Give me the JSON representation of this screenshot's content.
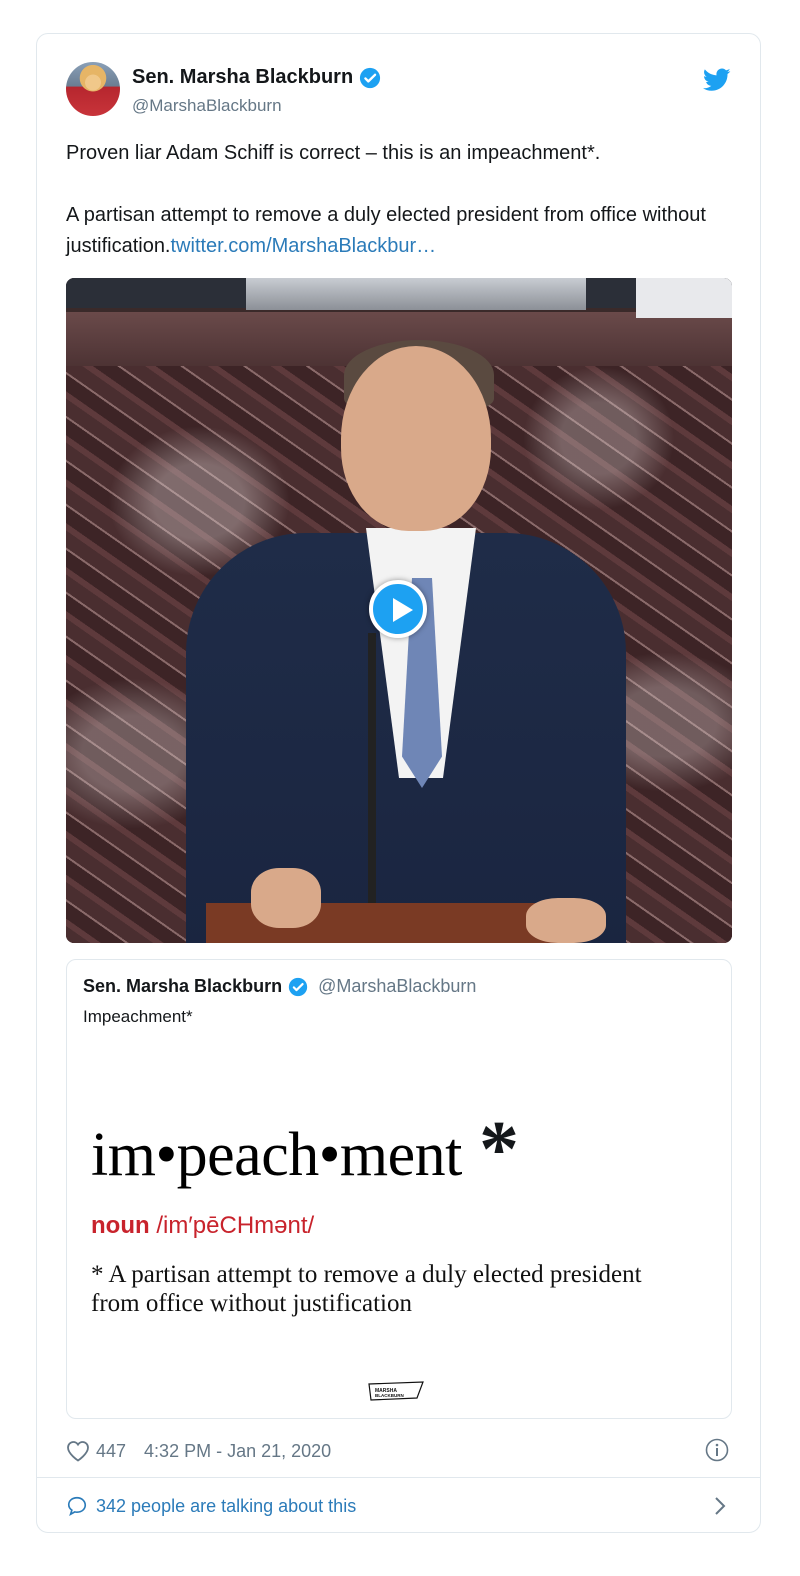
{
  "tweet": {
    "author_name": "Sen. Marsha Blackburn",
    "author_handle": "@MarshaBlackburn",
    "text_line1": "Proven liar Adam Schiff is correct – this is an impeachment*.",
    "text_line2": "A partisan attempt to remove a duly elected president from office without justification.",
    "link_text": "twitter.com/MarshaBlackbur…"
  },
  "quoted_tweet": {
    "author_name": "Sen. Marsha Blackburn",
    "author_handle": "@MarshaBlackburn",
    "text": "Impeachment*",
    "image": {
      "word": "im•peach•ment",
      "star": "*",
      "pos": "noun",
      "pronunciation": "/im′pēCHmənt/",
      "definition": "* A partisan attempt to remove a duly elected president from office without justification",
      "logo_text": "MARSHA BLACKBURN"
    }
  },
  "footer": {
    "like_count": "447",
    "timestamp": "4:32 PM - Jan 21, 2020",
    "talking": "342 people are talking about this"
  },
  "colors": {
    "twitter_blue": "#1da1f2",
    "link": "#2b7bb9",
    "secondary": "#657786",
    "definition_red": "#c8232c"
  },
  "icons": {
    "brand": "twitter-bird-icon",
    "verified": "verified-badge-icon",
    "play": "play-icon",
    "like": "heart-icon",
    "info": "info-icon",
    "reply": "speech-bubble-icon",
    "more": "chevron-right-icon"
  }
}
